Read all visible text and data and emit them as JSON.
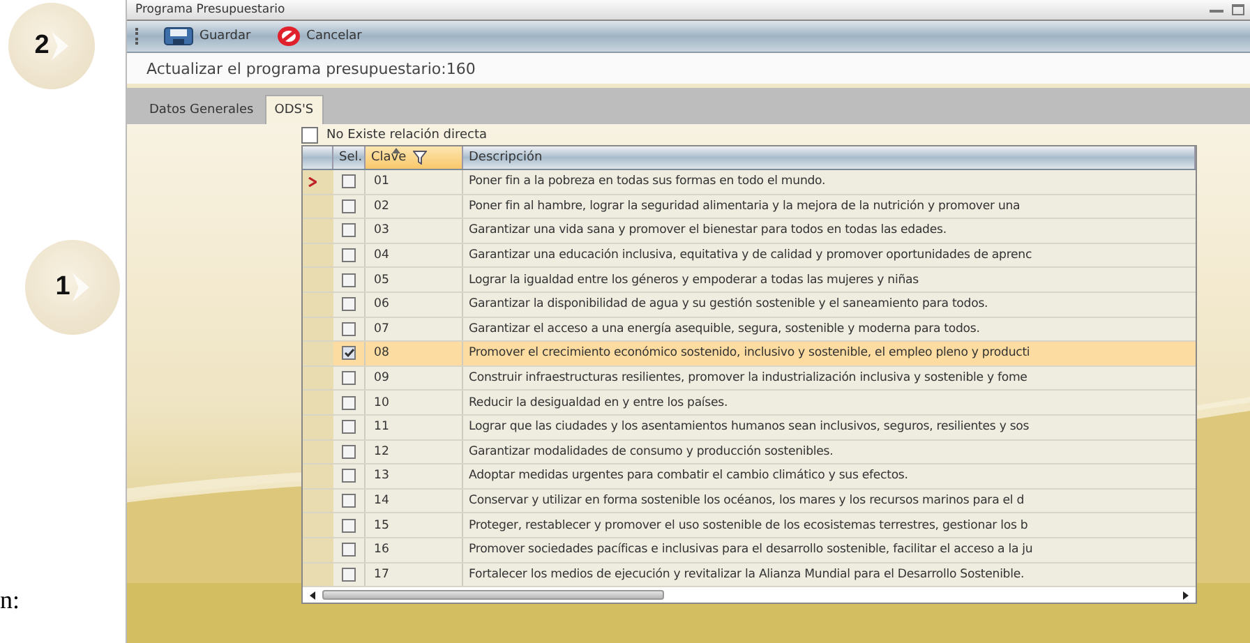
{
  "steps": [
    {
      "number": "2"
    },
    {
      "number": "1"
    }
  ],
  "side_text": "n:",
  "window": {
    "title": "Programa Presupuestario"
  },
  "toolbar": [
    {
      "kind": "save",
      "label": "Guardar"
    },
    {
      "kind": "cancel",
      "label": "Cancelar"
    }
  ],
  "heading": "Actualizar el programa presupuestario:160",
  "tabs": [
    {
      "label": "Datos Generales",
      "selected": false
    },
    {
      "label": "ODS'S",
      "selected": true
    }
  ],
  "no_relation": {
    "label": "No Existe relación directa",
    "checked": false
  },
  "table": {
    "columns": [
      "Sel.",
      "Clave",
      "Descripción"
    ],
    "rows": [
      {
        "clave": "01",
        "descripcion": "Poner fin a la pobreza en todas sus formas en todo el mundo.",
        "checked": false,
        "selected": false,
        "current": true
      },
      {
        "clave": "02",
        "descripcion": "Poner fin al hambre, lograr la seguridad alimentaria y la mejora de la nutrición y promover una",
        "checked": false,
        "selected": false,
        "current": false
      },
      {
        "clave": "03",
        "descripcion": "Garantizar una vida sana y promover el bienestar para todos en todas las edades.",
        "checked": false,
        "selected": false,
        "current": false
      },
      {
        "clave": "04",
        "descripcion": "Garantizar una educación inclusiva, equitativa y de calidad y promover oportunidades de aprenc",
        "checked": false,
        "selected": false,
        "current": false
      },
      {
        "clave": "05",
        "descripcion": "Lograr la igualdad entre los géneros y empoderar a todas las mujeres y niñas",
        "checked": false,
        "selected": false,
        "current": false
      },
      {
        "clave": "06",
        "descripcion": "Garantizar la disponibilidad de agua y su gestión sostenible y el saneamiento para todos.",
        "checked": false,
        "selected": false,
        "current": false
      },
      {
        "clave": "07",
        "descripcion": "Garantizar el acceso a una energía asequible, segura, sostenible y moderna para todos.",
        "checked": false,
        "selected": false,
        "current": false
      },
      {
        "clave": "08",
        "descripcion": "Promover el crecimiento económico sostenido, inclusivo y sostenible, el empleo pleno y producti",
        "checked": true,
        "selected": true,
        "current": false
      },
      {
        "clave": "09",
        "descripcion": "Construir infraestructuras resilientes, promover la industrialización inclusiva y sostenible y fome",
        "checked": false,
        "selected": false,
        "current": false
      },
      {
        "clave": "10",
        "descripcion": "Reducir la desigualdad en y entre los países.",
        "checked": false,
        "selected": false,
        "current": false
      },
      {
        "clave": "11",
        "descripcion": "Lograr que las ciudades y los asentamientos humanos sean inclusivos, seguros, resilientes y sos",
        "checked": false,
        "selected": false,
        "current": false
      },
      {
        "clave": "12",
        "descripcion": "Garantizar modalidades de consumo y producción sostenibles.",
        "checked": false,
        "selected": false,
        "current": false
      },
      {
        "clave": "13",
        "descripcion": "Adoptar medidas urgentes para combatir el cambio climático y sus efectos.",
        "checked": false,
        "selected": false,
        "current": false
      },
      {
        "clave": "14",
        "descripcion": "Conservar y utilizar en forma sostenible los océanos, los mares y los recursos marinos para el d",
        "checked": false,
        "selected": false,
        "current": false
      },
      {
        "clave": "15",
        "descripcion": "Proteger, restablecer y promover el uso sostenible de los ecosistemas terrestres, gestionar los b",
        "checked": false,
        "selected": false,
        "current": false
      },
      {
        "clave": "16",
        "descripcion": "Promover sociedades pacíficas e inclusivas para el desarrollo sostenible, facilitar el acceso a la ju",
        "checked": false,
        "selected": false,
        "current": false
      },
      {
        "clave": "17",
        "descripcion": "Fortalecer los medios de ejecución y revitalizar la Alianza Mundial para el Desarrollo Sostenible.",
        "checked": false,
        "selected": false,
        "current": false
      }
    ]
  }
}
